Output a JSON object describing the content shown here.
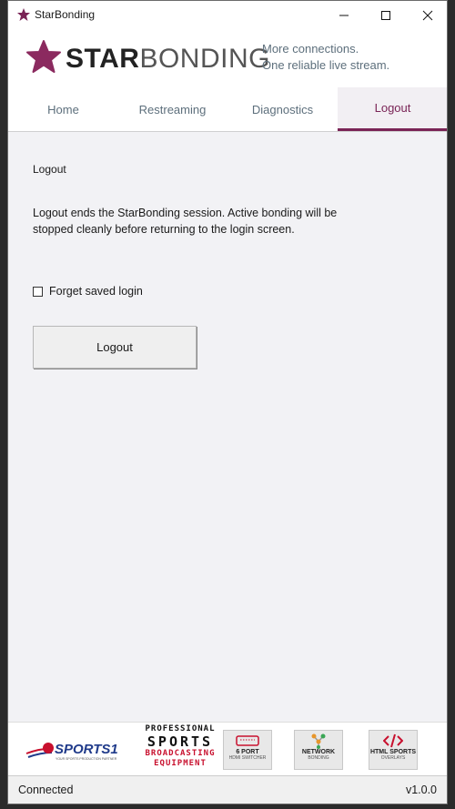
{
  "window": {
    "title": "StarBonding"
  },
  "brand": {
    "name_bold": "STAR",
    "name_light": "BONDING",
    "tagline_line1": "More connections.",
    "tagline_line2": "One reliable live stream.",
    "accent": "#7a2456"
  },
  "tabs": [
    {
      "label": "Home",
      "active": false
    },
    {
      "label": "Restreaming",
      "active": false
    },
    {
      "label": "Diagnostics",
      "active": false
    },
    {
      "label": "Logout",
      "active": true
    }
  ],
  "logout_page": {
    "heading": "Logout",
    "description": "Logout ends the StarBonding session. Active bonding will be stopped cleanly before returning to the login screen.",
    "checkbox_label": "Forget saved login",
    "checkbox_checked": false,
    "button_label": "Logout"
  },
  "sponsors": {
    "sports1": {
      "name": "SPORTS1",
      "tagline": "YOUR SPORTS PRODUCTION PARTNER"
    },
    "psbe": {
      "line1": "PROFESSIONAL",
      "line2": "SPORTS",
      "line3": "BROADCASTING",
      "line4": "EQUIPMENT"
    },
    "products": [
      {
        "icon": "hdmi-port-icon",
        "line1": "6 PORT",
        "line2": "HDMI SWITCHER"
      },
      {
        "icon": "network-icon",
        "line1": "NETWORK",
        "line2": "BONDING"
      },
      {
        "icon": "code-icon",
        "line1": "HTML SPORTS",
        "line2": "OVERLAYS"
      }
    ]
  },
  "status": {
    "connection": "Connected",
    "version": "v1.0.0"
  }
}
